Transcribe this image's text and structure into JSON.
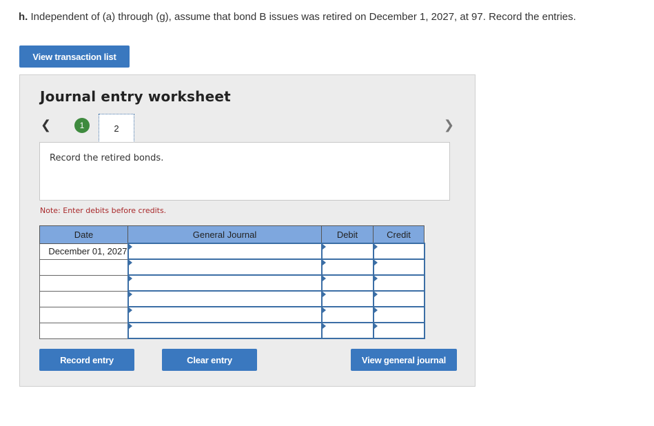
{
  "question": {
    "prefix": "h.",
    "text": "Independent of (a) through (g), assume that bond B issues was retired on December 1, 2027, at 97. Record the entries."
  },
  "buttons": {
    "view_transaction_list": "View transaction list",
    "record_entry": "Record entry",
    "clear_entry": "Clear entry",
    "view_general_journal": "View general journal"
  },
  "worksheet": {
    "title": "Journal entry worksheet",
    "steps": [
      "1",
      "2"
    ],
    "current_step": "2",
    "description": "Record the retired bonds.",
    "note": "Note: Enter debits before credits."
  },
  "journal": {
    "headers": [
      "Date",
      "General Journal",
      "Debit",
      "Credit"
    ],
    "rows": [
      {
        "date": "December 01, 2027",
        "account": "",
        "debit": "",
        "credit": ""
      },
      {
        "date": "",
        "account": "",
        "debit": "",
        "credit": ""
      },
      {
        "date": "",
        "account": "",
        "debit": "",
        "credit": ""
      },
      {
        "date": "",
        "account": "",
        "debit": "",
        "credit": ""
      },
      {
        "date": "",
        "account": "",
        "debit": "",
        "credit": ""
      },
      {
        "date": "",
        "account": "",
        "debit": "",
        "credit": ""
      }
    ]
  },
  "colors": {
    "button": "#3a78bf",
    "header": "#7ea7de",
    "step_complete": "#3e8a3e",
    "note": "#a8282a"
  },
  "icons": {
    "prev": "chevron-left-icon",
    "next": "chevron-right-icon"
  }
}
